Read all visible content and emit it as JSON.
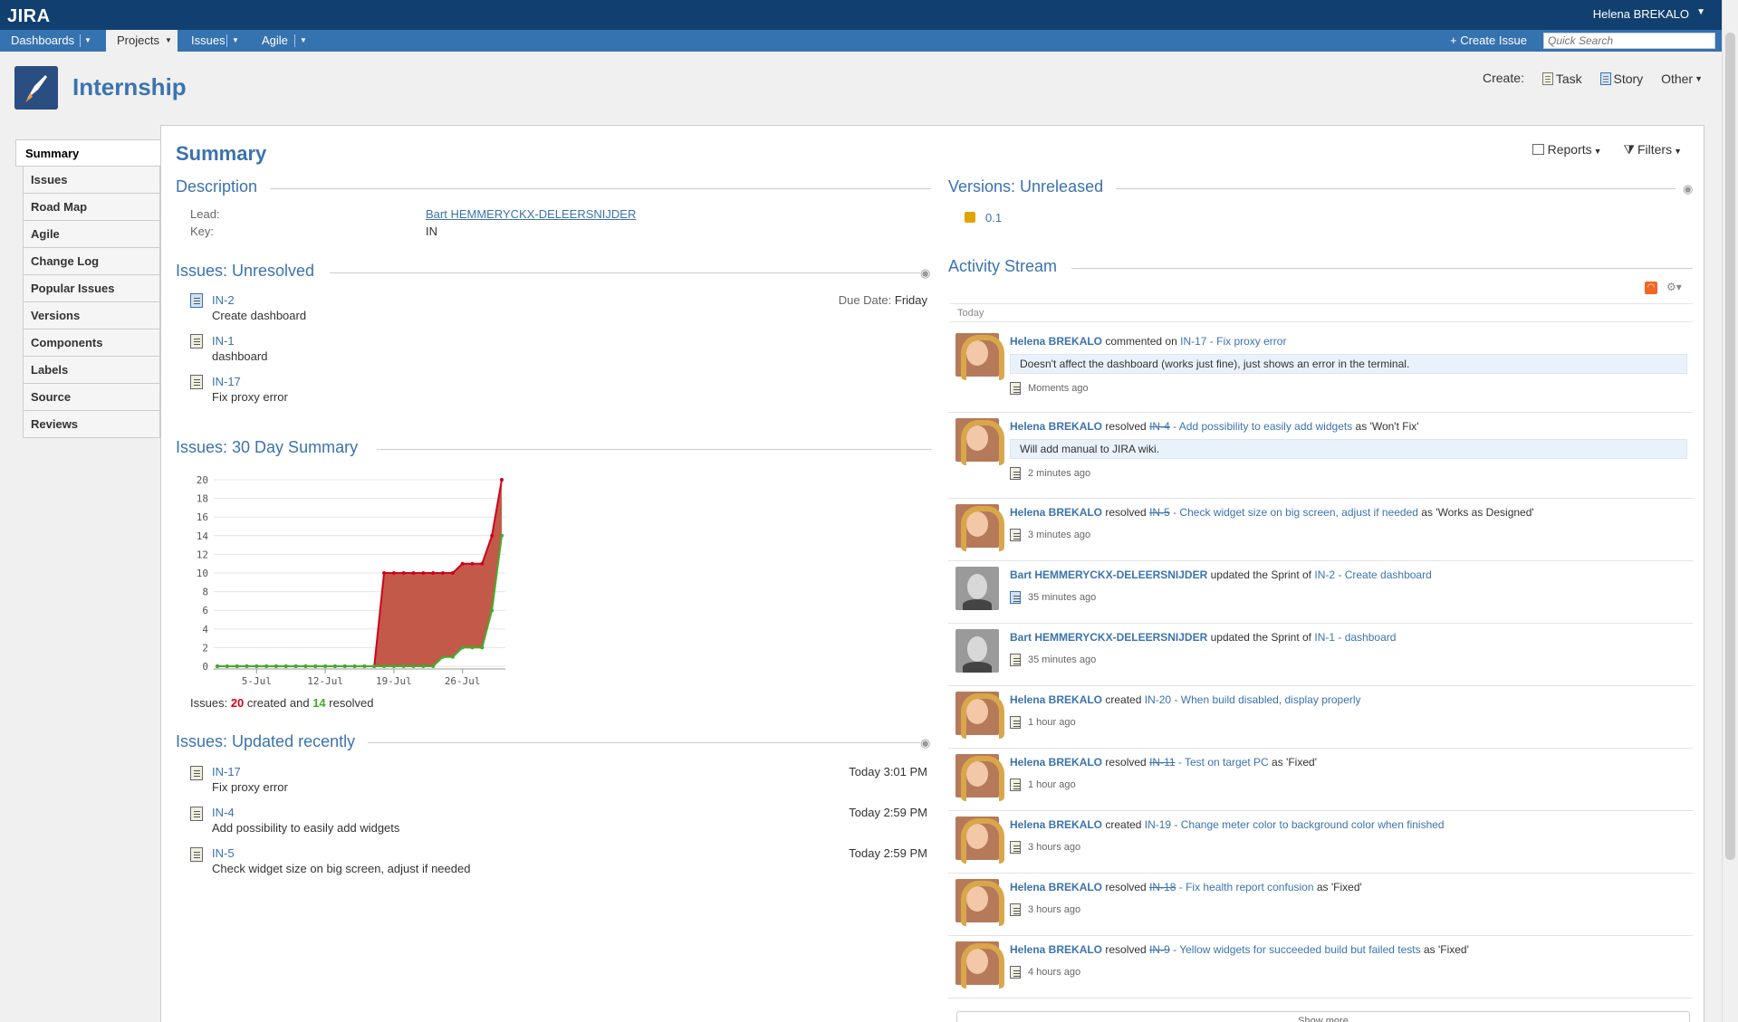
{
  "app": {
    "logo": "JIRA",
    "user": "Helena BREKALO"
  },
  "nav": {
    "items": [
      "Dashboards",
      "Projects",
      "Issues",
      "Agile"
    ],
    "create_issue": "Create Issue",
    "search_placeholder": "Quick Search"
  },
  "project": {
    "name": "Internship",
    "create_label": "Create:",
    "create_task": "Task",
    "create_story": "Story",
    "create_other": "Other"
  },
  "sidebar": {
    "items": [
      "Summary",
      "Issues",
      "Road Map",
      "Agile",
      "Change Log",
      "Popular Issues",
      "Versions",
      "Components",
      "Labels",
      "Source",
      "Reviews"
    ]
  },
  "main": {
    "title": "Summary",
    "reports": "Reports",
    "filters": "Filters"
  },
  "description": {
    "title": "Description",
    "lead_label": "Lead:",
    "lead_value": "Bart HEMMERYCKX-DELEERSNIJDER",
    "key_label": "Key:",
    "key_value": "IN"
  },
  "unresolved": {
    "title": "Issues: Unresolved",
    "items": [
      {
        "key": "IN-2",
        "summary": "Create dashboard",
        "due_label": "Due Date:",
        "due": "Friday"
      },
      {
        "key": "IN-1",
        "summary": "dashboard"
      },
      {
        "key": "IN-17",
        "summary": "Fix proxy error"
      }
    ]
  },
  "summary30": {
    "title": "Issues: 30 Day Summary",
    "footer_prefix": "Issues:",
    "created_count": "20",
    "created_text": "created and",
    "resolved_count": "14",
    "resolved_text": "resolved"
  },
  "chart_data": {
    "type": "area",
    "x": [
      "Jul 1",
      "Jul 2",
      "Jul 3",
      "Jul 4",
      "Jul 5",
      "Jul 6",
      "Jul 7",
      "Jul 8",
      "Jul 9",
      "Jul 10",
      "Jul 11",
      "Jul 12",
      "Jul 13",
      "Jul 14",
      "Jul 15",
      "Jul 16",
      "Jul 17",
      "Jul 18",
      "Jul 19",
      "Jul 20",
      "Jul 21",
      "Jul 22",
      "Jul 23",
      "Jul 24",
      "Jul 25",
      "Jul 26",
      "Jul 27",
      "Jul 28",
      "Jul 29",
      "Jul 30"
    ],
    "xticks": [
      "5-Jul",
      "12-Jul",
      "19-Jul",
      "26-Jul"
    ],
    "yticks": [
      0,
      2,
      4,
      6,
      8,
      10,
      12,
      14,
      16,
      18,
      20
    ],
    "ylim": [
      0,
      20
    ],
    "series": [
      {
        "color": "#d0021b",
        "values": [
          0,
          0,
          0,
          0,
          0,
          0,
          0,
          0,
          0,
          0,
          0,
          0,
          0,
          0,
          0,
          0,
          0,
          10,
          10,
          10,
          10,
          10,
          10,
          10,
          10,
          11,
          11,
          11,
          14,
          20
        ]
      },
      {
        "color": "#3fae29",
        "values": [
          0,
          0,
          0,
          0,
          0,
          0,
          0,
          0,
          0,
          0,
          0,
          0,
          0,
          0,
          0,
          0,
          0,
          0,
          0,
          0,
          0,
          0,
          0,
          1,
          1,
          2,
          2,
          2,
          6,
          14
        ]
      }
    ]
  },
  "updated": {
    "title": "Issues: Updated recently",
    "items": [
      {
        "key": "IN-17",
        "summary": "Fix proxy error",
        "time": "Today 3:01 PM"
      },
      {
        "key": "IN-4",
        "summary": "Add possibility to easily add widgets",
        "time": "Today 2:59 PM"
      },
      {
        "key": "IN-5",
        "summary": "Check widget size on big screen, adjust if needed",
        "time": "Today 2:59 PM"
      }
    ]
  },
  "versions": {
    "title": "Versions: Unreleased",
    "items": [
      "0.1"
    ]
  },
  "activity": {
    "title": "Activity Stream",
    "group": "Today",
    "show_more": "Show more",
    "items": [
      {
        "who": "Helena BREKALO",
        "verb": "commented on",
        "key": "IN-17",
        "summary": "- Fix proxy error",
        "tail": "",
        "comment": "Doesn't affect the dashboard (works just fine), just shows an error in the terminal.",
        "time": "Moments ago"
      },
      {
        "who": "Helena BREKALO",
        "verb": "resolved",
        "key": "IN-4",
        "summary": "- Add possibility to easily add widgets",
        "tail": "as 'Won't Fix'",
        "comment": "Will add manual to JIRA wiki.",
        "time": "2 minutes ago"
      },
      {
        "who": "Helena BREKALO",
        "verb": "resolved",
        "key": "IN-5",
        "summary": "- Check widget size on big screen, adjust if needed",
        "tail": "as 'Works as Designed'",
        "comment": "",
        "time": "3 minutes ago"
      },
      {
        "who": "Bart HEMMERYCKX-DELEERSNIJDER",
        "verb": "updated the Sprint of",
        "key": "IN-2",
        "summary": "- Create dashboard",
        "tail": "",
        "comment": "",
        "time": "35 minutes ago"
      },
      {
        "who": "Bart HEMMERYCKX-DELEERSNIJDER",
        "verb": "updated the Sprint of",
        "key": "IN-1",
        "summary": "- dashboard",
        "tail": "",
        "comment": "",
        "time": "35 minutes ago"
      },
      {
        "who": "Helena BREKALO",
        "verb": "created",
        "key": "IN-20",
        "summary": "- When build disabled, display properly",
        "tail": "",
        "comment": "",
        "time": "1 hour ago"
      },
      {
        "who": "Helena BREKALO",
        "verb": "resolved",
        "key": "IN-11",
        "summary": "- Test on target PC",
        "tail": "as 'Fixed'",
        "comment": "",
        "time": "1 hour ago"
      },
      {
        "who": "Helena BREKALO",
        "verb": "created",
        "key": "IN-19",
        "summary": "- Change meter color to background color when finished",
        "tail": "",
        "comment": "",
        "time": "3 hours ago"
      },
      {
        "who": "Helena BREKALO",
        "verb": "resolved",
        "key": "IN-18",
        "summary": "- Fix health report confusion",
        "tail": "as 'Fixed'",
        "comment": "",
        "time": "3 hours ago"
      },
      {
        "who": "Helena BREKALO",
        "verb": "resolved",
        "key": "IN-9",
        "summary": "- Yellow widgets for succeeded build but failed tests",
        "tail": "as 'Fixed'",
        "comment": "",
        "time": "4 hours ago"
      }
    ]
  }
}
